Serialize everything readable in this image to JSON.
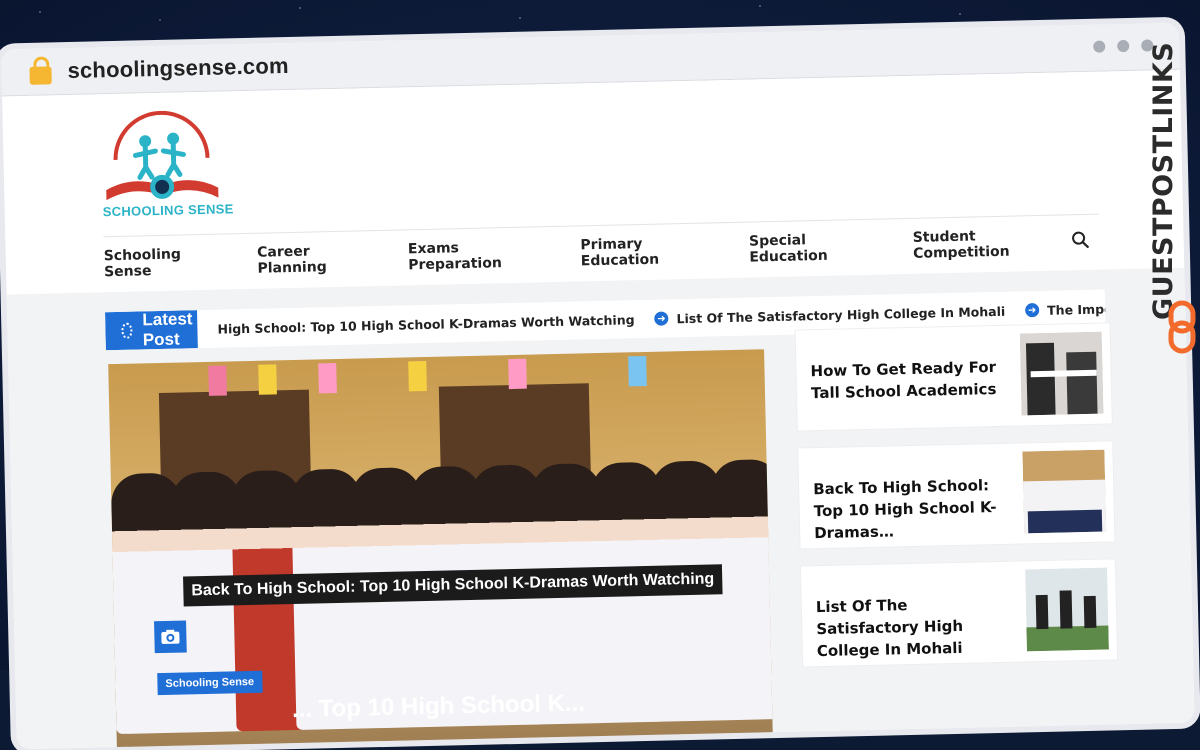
{
  "browser": {
    "url": "schoolingsense.com"
  },
  "site": {
    "logo_text": "SCHOOLING SENSE",
    "nav": [
      "Schooling Sense",
      "Career Planning",
      "Exams Preparation",
      "Primary Education",
      "Special Education",
      "Student Competition"
    ],
    "ticker": {
      "label": "Latest Post",
      "items": [
        "High School: Top 10 High School K-Dramas Worth Watching",
        "List Of The Satisfactory High College In Mohali",
        "The Importance Of The Five Senses In S"
      ]
    },
    "hero": {
      "caption": "Back To High School: Top 10 High School K-Dramas Worth Watching",
      "category": "Schooling Sense",
      "title_partial": "... Top 10 High School K..."
    },
    "cards": [
      {
        "title": "How To Get Ready For Tall School Academics"
      },
      {
        "title": "Back To High School: Top 10 High School K-Dramas…"
      },
      {
        "title": "List Of The Satisfactory High College In Mohali"
      }
    ]
  },
  "watermark": {
    "text": "GUESTPOSTLINKS"
  },
  "colors": {
    "accent": "#1f6fd6",
    "logo_teal": "#2bb3c7",
    "logo_red": "#d23b2f",
    "watermark_orange": "#f26b2c"
  }
}
